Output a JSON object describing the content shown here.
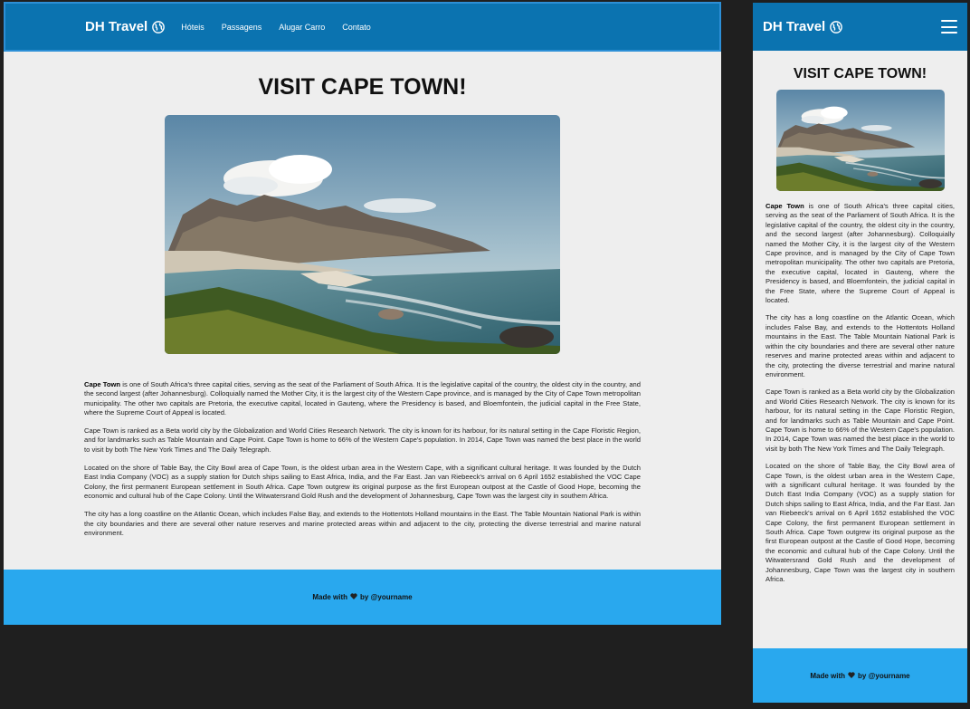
{
  "brand": {
    "name": "DH Travel"
  },
  "nav": {
    "items": [
      "Hóteis",
      "Passagens",
      "Alugar Carro",
      "Contato"
    ]
  },
  "page": {
    "title": "VISIT CAPE TOWN!",
    "p1_strong": "Cape Town",
    "p1": " is one of South Africa's three capital cities, serving as the seat of the Parliament of South Africa. It is the legislative capital of the country, the oldest city in the country, and the second largest (after Johannesburg). Colloquially named the Mother City, it is the largest city of the Western Cape province, and is managed by the City of Cape Town metropolitan municipality. The other two capitals are Pretoria, the executive capital, located in Gauteng, where the Presidency is based, and Bloemfontein, the judicial capital in the Free State, where the Supreme Court of Appeal is located.",
    "p2": "Cape Town is ranked as a Beta world city by the Globalization and World Cities Research Network. The city is known for its harbour, for its natural setting in the Cape Floristic Region, and for landmarks such as Table Mountain and Cape Point. Cape Town is home to 66% of the Western Cape's population. In 2014, Cape Town was named the best place in the world to visit by both The New York Times and The Daily Telegraph.",
    "p3": "Located on the shore of Table Bay, the City Bowl area of Cape Town, is the oldest urban area in the Western Cape, with a significant cultural heritage. It was founded by the Dutch East India Company (VOC) as a supply station for Dutch ships sailing to East Africa, India, and the Far East. Jan van Riebeeck's arrival on 6 April 1652 established the VOC Cape Colony, the first permanent European settlement in South Africa. Cape Town outgrew its original purpose as the first European outpost at the Castle of Good Hope, becoming the economic and cultural hub of the Cape Colony. Until the Witwatersrand Gold Rush and the development of Johannesburg, Cape Town was the largest city in southern Africa.",
    "p4": "The city has a long coastline on the Atlantic Ocean, which includes False Bay, and extends to the Hottentots Holland mountains in the East. The Table Mountain National Park is within the city boundaries and there are several other nature reserves and marine protected areas within and adjacent to the city, protecting the diverse terrestrial and marine natural environment."
  },
  "footer": {
    "made_with": "Made with",
    "by": "by @yourname"
  },
  "icons": {
    "brand": "globe-icon",
    "menu": "hamburger-menu-icon",
    "footer": "heart-icon"
  },
  "colors": {
    "header": "#0b73b0",
    "footer": "#29a8ee",
    "background": "#eeeeee",
    "page": "#1f1f1f"
  }
}
